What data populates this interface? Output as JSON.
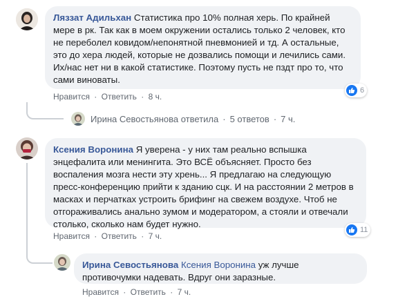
{
  "comments": [
    {
      "author": "Ляззат Адильхан",
      "text": "Статистика про 10% полная херь. По крайней мере в рк. Так как в моем окружении остались только 2 человек, кто не переболел ковидом/непонятной пневмонией и тд. А остальные, это до хера людей, которые не дозвались помощи и лечились сами. Их/нас нет ни в какой статистике. Поэтому пусть не пздт про то, что сами виноваты.",
      "like_label": "Нравится",
      "reply_label": "Ответить",
      "time": "8 ч.",
      "reactions": "6"
    },
    {
      "author": "Ксения Воронина",
      "text": "Я уверена - у них там реально вспышка энцефалита или менингита. Это ВСЁ объясняет. Просто без воспаления мозга нести эту хрень... Я предлагаю на следующую пресс-конференцию прийти к зданию сцк. И на расстоянии 2 метров в масках и перчатках устроить брифинг на свежем воздухе. Чтоб не отгораживались анально зумом и модератором, а стояли и отвечали столько, сколько нам будет нужно.",
      "like_label": "Нравится",
      "reply_label": "Ответить",
      "time": "7 ч.",
      "reactions": "11"
    }
  ],
  "reply_summary": {
    "text": "Ирина Севостьянова ответила",
    "count": "5 ответов",
    "time": "7 ч."
  },
  "reply": {
    "author": "Ирина Севостьянова",
    "mention": "Ксения Воронина",
    "text": "уж лучше противочумки надевать. Вдруг они заразные.",
    "like_label": "Нравится",
    "reply_label": "Ответить",
    "time": "7 ч."
  },
  "separator": "·",
  "colors": {
    "link": "#385898",
    "bubble": "#f0f2f5",
    "like": "#1877f2"
  }
}
